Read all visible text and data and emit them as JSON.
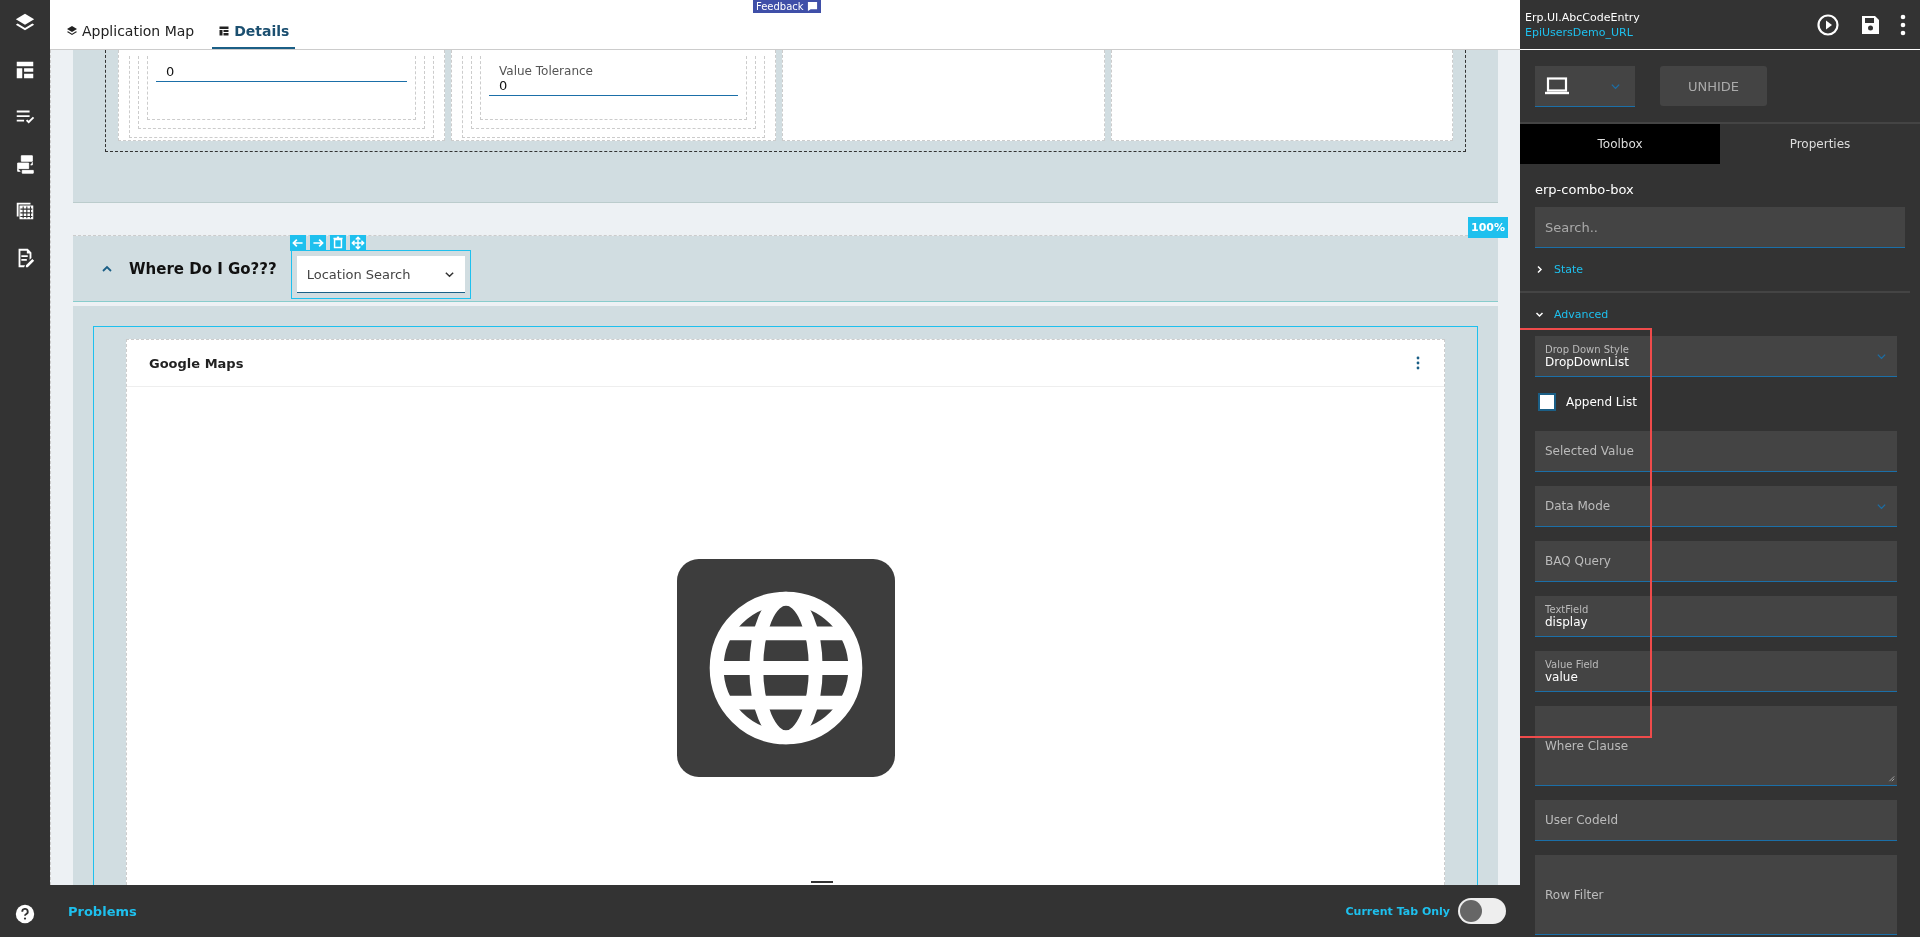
{
  "feedback": {
    "label": "Feedback"
  },
  "designer_tabs": [
    {
      "label": "Application Map",
      "selected": false
    },
    {
      "label": "Details",
      "selected": true
    }
  ],
  "upper_panel": {
    "fields": [
      {
        "value": "0"
      },
      {
        "label": "Value Tolerance",
        "value": "0"
      }
    ]
  },
  "zoom_badge": "100%",
  "group": {
    "title": "Where Do I Go???",
    "expanded": true,
    "combo": {
      "label": "Location Search"
    }
  },
  "card": {
    "title": "Google Maps"
  },
  "problems_bar": {
    "label": "Problems",
    "toggle": {
      "label": "Current Tab Only",
      "on": false
    }
  },
  "header": {
    "title": "Erp.UI.AbcCodeEntry",
    "subtitle": "EpiUsersDemo_URL"
  },
  "unhide_button": "UNHIDE",
  "panel_tabs": [
    {
      "label": "Toolbox",
      "selected": true
    },
    {
      "label": "Properties",
      "selected": false
    }
  ],
  "component_name": "erp-combo-box",
  "search": {
    "placeholder": "Search.."
  },
  "sections": [
    {
      "label": "State",
      "expanded": false
    },
    {
      "label": "Advanced",
      "expanded": true
    }
  ],
  "properties": [
    {
      "kind": "select",
      "label": "Drop Down Style",
      "value": "DropDownList"
    },
    {
      "kind": "checkbox",
      "label": "Append List",
      "checked": false
    },
    {
      "kind": "text",
      "label": "Selected Value"
    },
    {
      "kind": "select",
      "label": "Data Mode"
    },
    {
      "kind": "text",
      "label": "BAQ Query"
    },
    {
      "kind": "text",
      "label": "TextField",
      "value": "display"
    },
    {
      "kind": "text",
      "label": "Value Field",
      "value": "value"
    },
    {
      "kind": "textarea",
      "label": "Where Clause"
    },
    {
      "kind": "text",
      "label": "User CodeId"
    },
    {
      "kind": "textarea",
      "label": "Row Filter"
    }
  ]
}
